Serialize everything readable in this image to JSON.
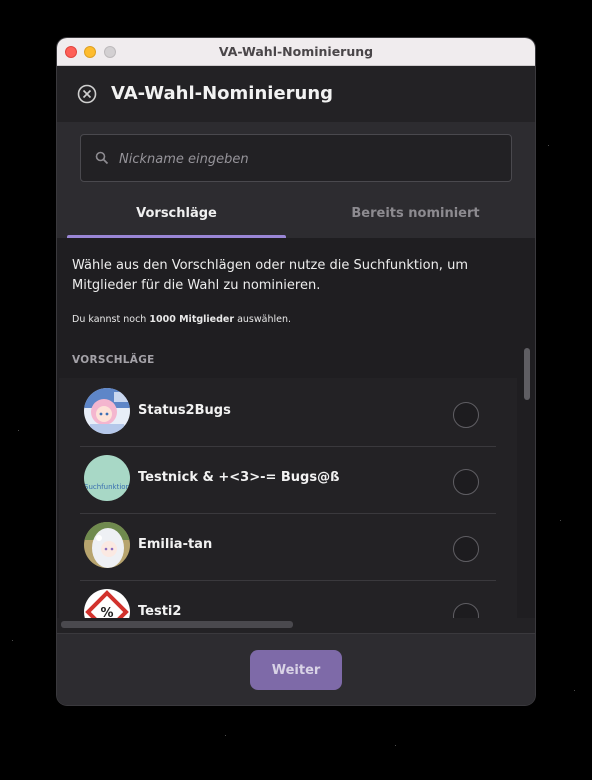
{
  "window": {
    "title": "VA-Wahl-Nominierung"
  },
  "header": {
    "title": "VA-Wahl-Nominierung",
    "close_icon": "close-circle-icon"
  },
  "search": {
    "placeholder": "Nickname eingeben",
    "value": "",
    "icon": "search-icon"
  },
  "tabs": [
    {
      "label": "Vorschläge",
      "active": true
    },
    {
      "label": "Bereits nominiert",
      "active": false
    }
  ],
  "intro": {
    "text": "Wähle aus den Vorschlägen oder nutze die Suchfunktion, um Mitglieder für die Wahl zu nominieren.",
    "quota_prefix": "Du kannst noch ",
    "quota_count": "1000 Mitglieder",
    "quota_suffix": " auswählen."
  },
  "suggestions": {
    "section_label": "VORSCHLÄGE",
    "items": [
      {
        "name": "Status2Bugs",
        "avatar": "pink-anime-avatar",
        "selected": false
      },
      {
        "name": "Testnick & +<3>-= Bugs@ß",
        "avatar": "mint-avatar",
        "avatar_text": "Suchfunktion",
        "selected": false
      },
      {
        "name": "Emilia-tan",
        "avatar": "silver-hair-avatar",
        "selected": false
      },
      {
        "name": "Testi2",
        "avatar": "sign-avatar",
        "selected": false
      }
    ]
  },
  "footer": {
    "next_label": "Weiter"
  },
  "colors": {
    "accent": "#9a86d6",
    "button": "#7e6aa8",
    "background": "#1f1e21"
  }
}
